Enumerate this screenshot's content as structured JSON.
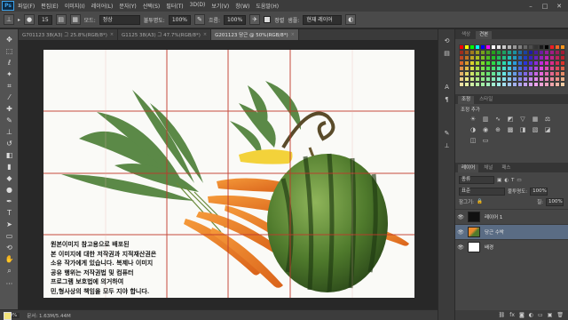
{
  "menubar": {
    "logo": "Ps",
    "items": [
      "파일(F)",
      "편집(E)",
      "이미지(I)",
      "레이어(L)",
      "문자(Y)",
      "선택(S)",
      "필터(T)",
      "3D(D)",
      "보기(V)",
      "창(W)",
      "도움말(H)"
    ]
  },
  "options": {
    "tool_preset": "▸",
    "sample_label": "견본:",
    "sample_value": "1픽셀",
    "brush_size": "15",
    "mode_label": "모드:",
    "mode_value": "정상",
    "opacity_label": "불투명도:",
    "opacity_value": "100%",
    "flow_label": "흐름:",
    "flow_value": "100%",
    "aligned_label": "정렬",
    "sample_layer_label": "샘플:",
    "sample_layer_value": "현재 레이어"
  },
  "tabs": [
    {
      "label": "G701123 38(A3) 그 25.8%(RGB/8*)",
      "active": false
    },
    {
      "label": "G1125 38(A3) 그 47.7%(RGB/8*)",
      "active": false
    },
    {
      "label": "G201123 당근 @ 50%(RGB/8*)",
      "active": true
    }
  ],
  "canvas": {
    "notice_lines": [
      "원본이미지 참고용으로 배포된",
      "본 이미지에 대한 저작권과 지적재산권은",
      "소유 작가에게 있습니다. 복제나 이미지",
      "공유 행위는 저작권법 및 컴퓨터",
      "프로그램 보호법에 의거하여",
      "민,형사상의 책임을 모두 지야 합니다."
    ]
  },
  "status": {
    "zoom": "50%",
    "doc": "문서: 1.63M/5.44M"
  },
  "panels": {
    "color_tab": "색상",
    "swatches_tab": "견본",
    "adjust_tab": "조정",
    "styles_tab": "스타일",
    "adjust_label": "조정 추가",
    "layers_tab": "레이어",
    "channels_tab": "채널",
    "paths_tab": "패스",
    "kind_value": "종류",
    "blend_value": "표준",
    "opacity_label": "불투명도:",
    "opacity_value": "100%",
    "lock_label": "잠그기:",
    "fill_label": "칠:",
    "fill_value": "100%"
  },
  "layers": [
    {
      "name": "레이어 1",
      "selected": false
    },
    {
      "name": "당근 수박",
      "selected": true
    },
    {
      "name": "배경",
      "selected": false
    }
  ],
  "colors": {
    "foreground": "#f2e37a",
    "background": "#ffffff",
    "guide": "#c0392b",
    "selected_layer": "#5a6c84"
  }
}
